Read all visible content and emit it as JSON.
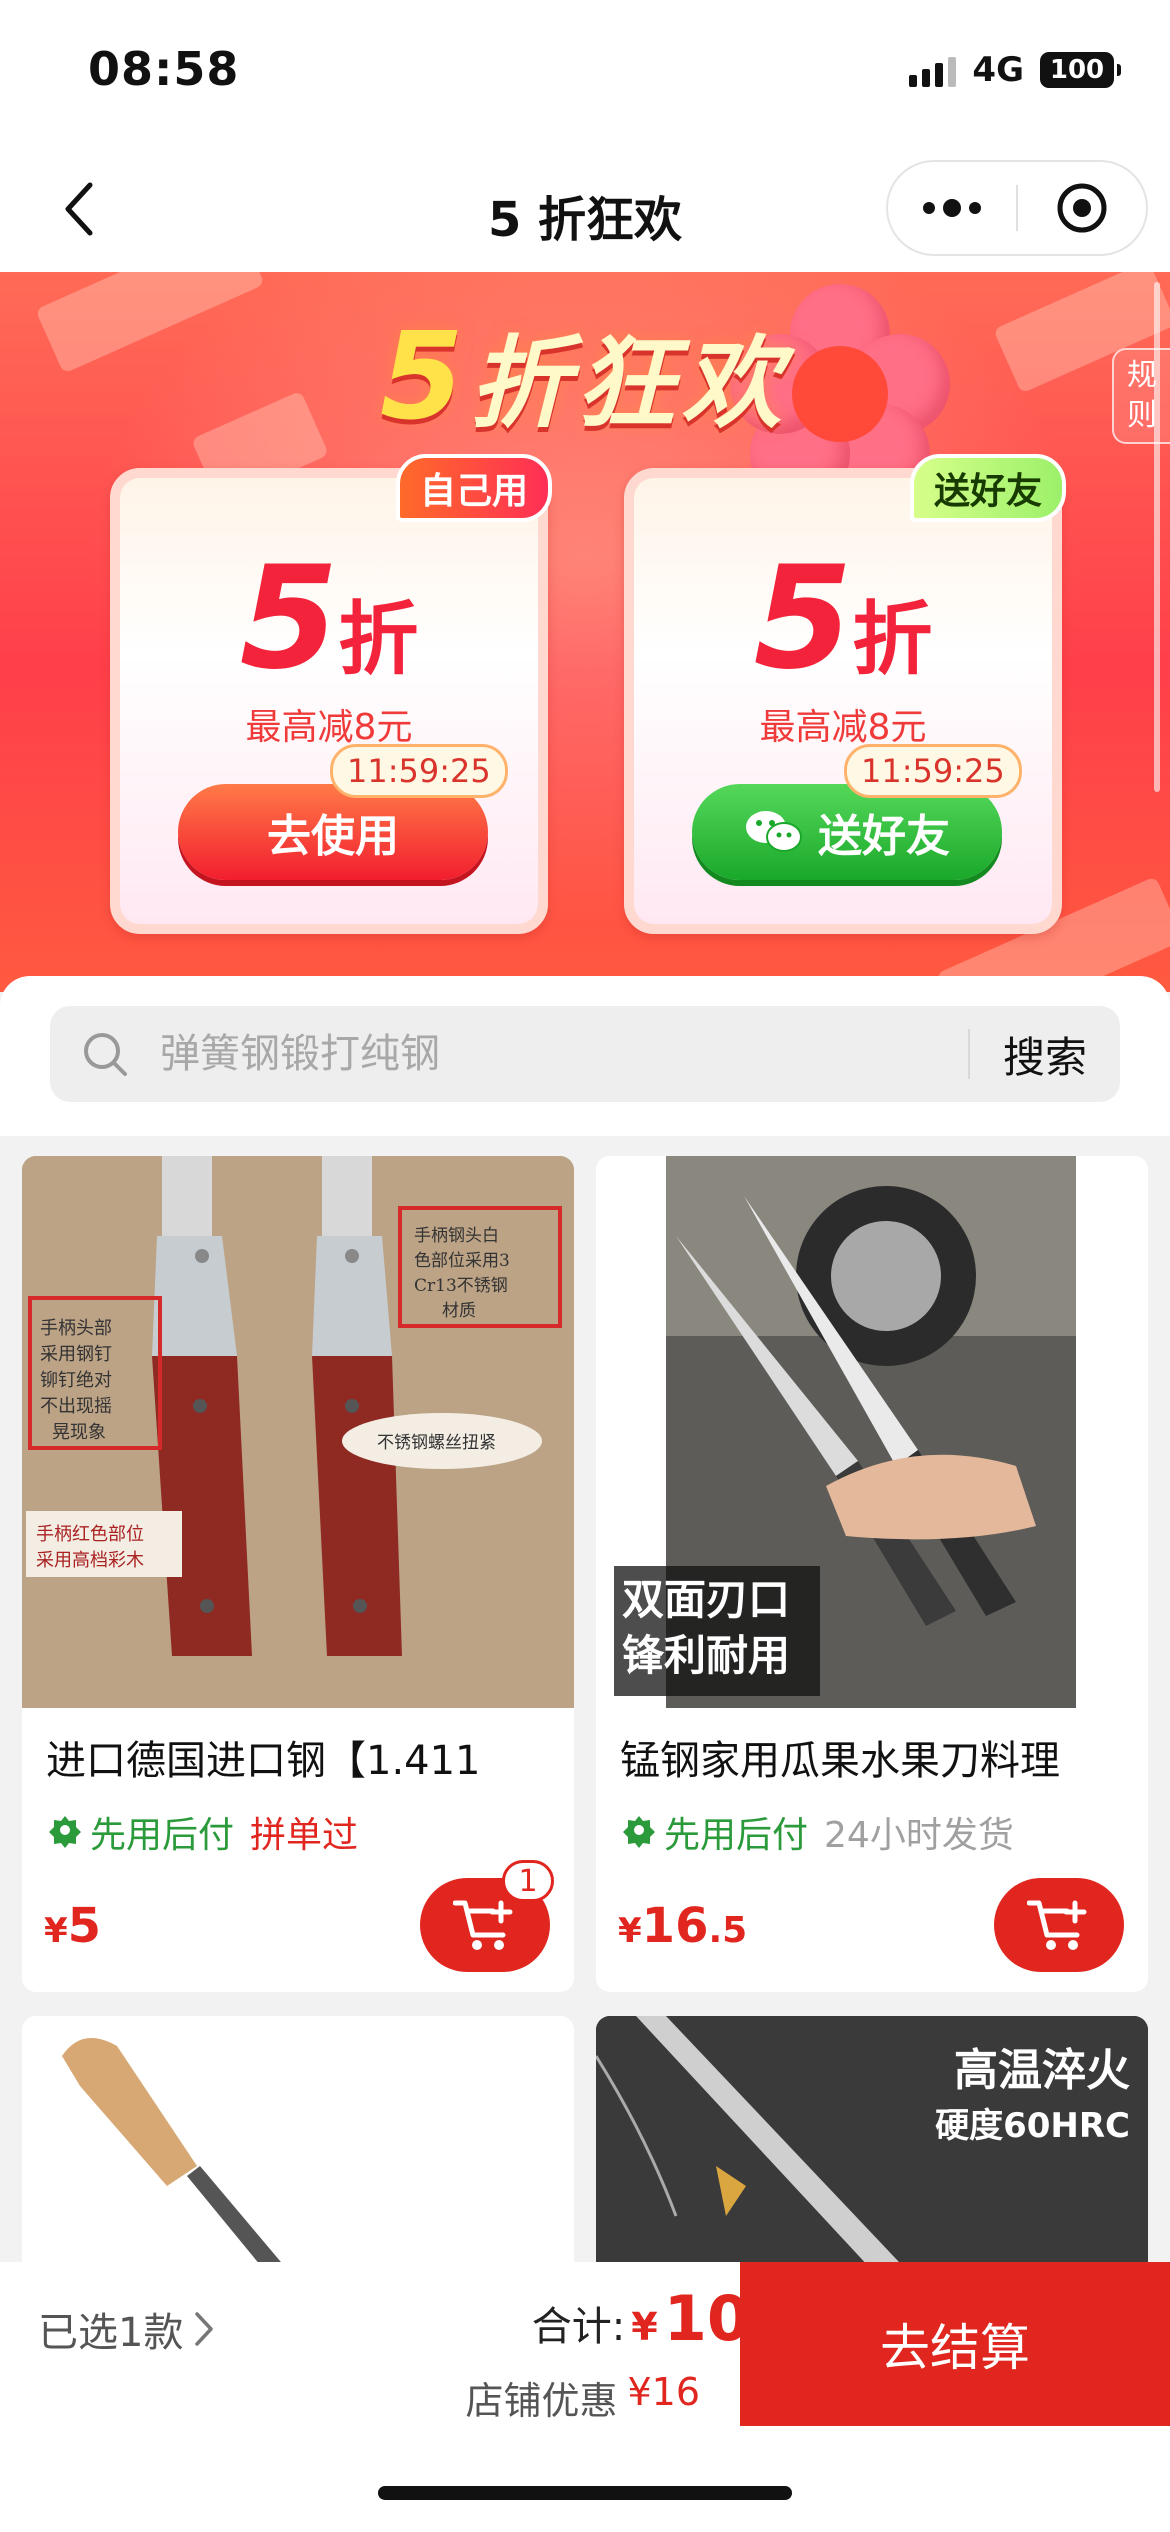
{
  "status_bar": {
    "time": "08:58",
    "network": "4G",
    "battery": "100"
  },
  "nav": {
    "title": "5 折狂欢"
  },
  "banner": {
    "title_prefix": "5",
    "title_rest": "折狂欢",
    "rules_label": "规则",
    "cards": [
      {
        "tag": "自己用",
        "discount_num": "5",
        "discount_unit": "折",
        "desc": "最高减8元",
        "countdown": "11:59:25",
        "button": "去使用"
      },
      {
        "tag": "送好友",
        "discount_num": "5",
        "discount_unit": "折",
        "desc": "最高减8元",
        "countdown": "11:59:25",
        "button": "送好友"
      }
    ]
  },
  "search": {
    "placeholder": "弹簧钢锻打纯钢",
    "button": "搜索"
  },
  "products": [
    {
      "name": "进口德国进口钢【1.411",
      "pay_later": "先用后付",
      "tag": "拼单过",
      "price_currency": "¥",
      "price_int": "5",
      "price_dec": "",
      "cart_badge": "1",
      "image_notes": [
        "手柄头部采用钢钉铆钉绝对不出现摇晃现象",
        "手柄钢头白色部位采用3Cr13不锈钢材质",
        "不锈钢螺丝扭紧",
        "手柄红色部位采用高档彩木"
      ]
    },
    {
      "name": "锰钢家用瓜果水果刀料理",
      "pay_later": "先用后付",
      "tag": "24小时发货",
      "price_currency": "¥",
      "price_int": "16",
      "price_dec": ".5",
      "image_caption": [
        "双面刃口",
        "锋利耐用"
      ]
    },
    {
      "name": "",
      "image_caption": []
    },
    {
      "name": "",
      "image_caption": [
        "高温淬火",
        "硬度60HRC"
      ]
    }
  ],
  "bottom_bar": {
    "selected": "已选1款",
    "total_label": "合计:",
    "total_currency": "¥",
    "total_value": "10",
    "discount_label": "店铺优惠",
    "discount_value": "¥16",
    "checkout": "去结算"
  },
  "colors": {
    "accent": "#e0261f",
    "green": "#2a9a3a",
    "banner": "#ff4a4a"
  }
}
